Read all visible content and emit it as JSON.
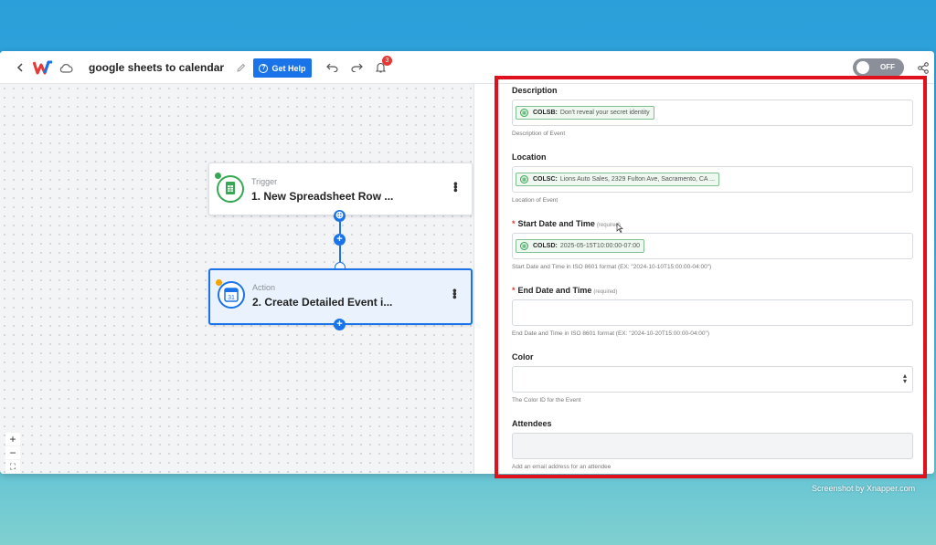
{
  "header": {
    "title": "google sheets to calendar",
    "help_label": "Get Help",
    "notification_count": "3",
    "toggle_label": "OFF",
    "toggle_on": false
  },
  "workflow": {
    "trigger": {
      "kind": "Trigger",
      "name": "1. New Spreadsheet Row ..."
    },
    "action": {
      "kind": "Action",
      "name": "2. Create Detailed Event i..."
    }
  },
  "zoom": {
    "in": "+",
    "out": "−",
    "fit": "⛶"
  },
  "form": {
    "description": {
      "label": "Description",
      "chip_key": "COLSB:",
      "chip_value": "Don't reveal your secret identity",
      "help": "Description of Event"
    },
    "location": {
      "label": "Location",
      "chip_key": "COLSC:",
      "chip_value": "Lions Auto Sales, 2329 Fulton Ave, Sacramento, CA ...",
      "help": "Location of Event"
    },
    "start": {
      "label": "Start Date and Time",
      "required": "(required)",
      "chip_key": "COLSD:",
      "chip_value": "2025-05-15T10:00:00-07:00",
      "help": "Start Date and Time in ISO 8601 format (EX: \"2024-10-10T15:00:00-04:00\")"
    },
    "end": {
      "label": "End Date and Time",
      "required": "(required)",
      "value": "",
      "help": "End Date and Time in ISO 8601 format (EX: \"2024-10-20T15:00:00-04:00\")"
    },
    "color": {
      "label": "Color",
      "value": "",
      "help": "The Color ID for the Event"
    },
    "attendees": {
      "label": "Attendees",
      "value": "",
      "help": "Add an email address for an attendee"
    }
  },
  "watermark": "Screenshot by Xnapper.com",
  "colors": {
    "accent": "#1a73e8",
    "highlight": "#e0101d",
    "sheets_green": "#34a853"
  }
}
